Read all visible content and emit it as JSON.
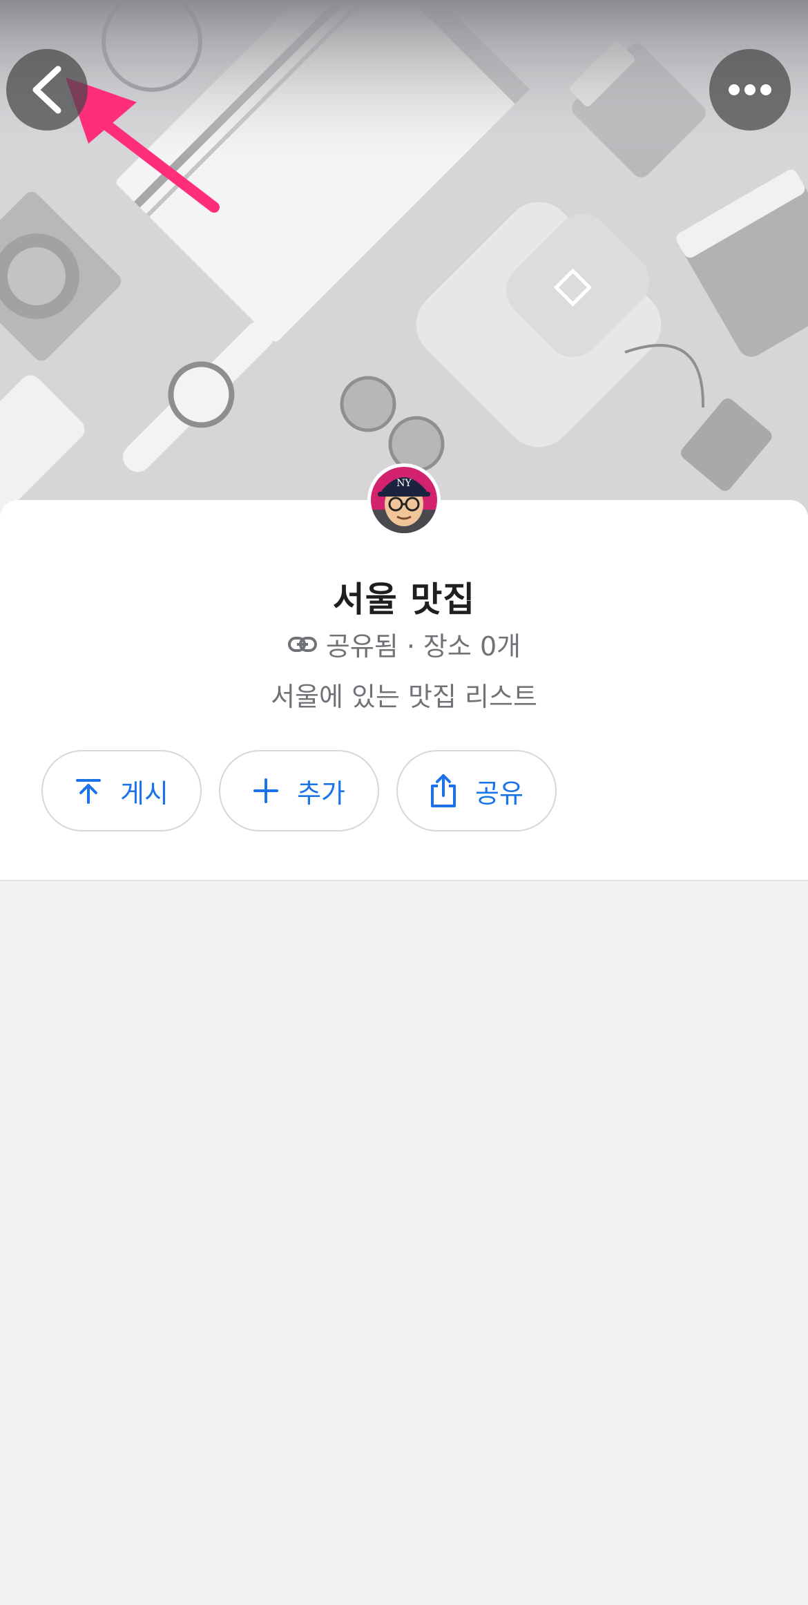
{
  "header": {
    "back_icon": "chevron-left-icon",
    "more_icon": "more-horizontal-icon",
    "accent_arrow_color": "#ff2e7a"
  },
  "list": {
    "title": "서울 맛집",
    "shared_label": "공유됨 · 장소 0개",
    "description": "서울에 있는 맛집 리스트"
  },
  "actions": {
    "post_label": "게시",
    "add_label": "추가",
    "share_label": "공유"
  },
  "colors": {
    "accent": "#1a73e8",
    "background": "#f0f1f3"
  }
}
